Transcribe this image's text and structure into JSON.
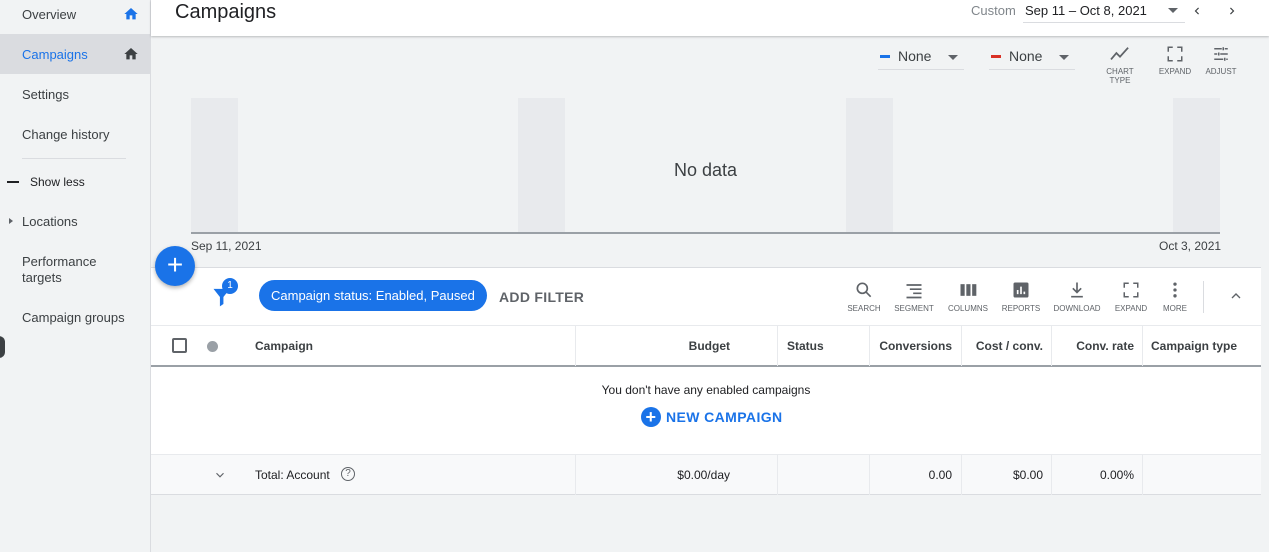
{
  "sidebar": {
    "items": [
      {
        "label": "Overview"
      },
      {
        "label": "Campaigns"
      },
      {
        "label": "Settings"
      },
      {
        "label": "Change history"
      }
    ],
    "show_less": "Show less",
    "sub_items": [
      {
        "label": "Locations"
      },
      {
        "label": "Performance targets"
      },
      {
        "label": "Campaign groups"
      }
    ]
  },
  "header": {
    "title": "Campaigns",
    "date_preset": "Custom",
    "date_range": "Sep 11 – Oct 8, 2021"
  },
  "chart_controls": {
    "metric1": {
      "label": "None",
      "color": "#1a73e8"
    },
    "metric2": {
      "label": "None",
      "color": "#d93025"
    },
    "chart_type": "CHART TYPE",
    "expand": "EXPAND",
    "adjust": "ADJUST"
  },
  "chart_data": {
    "type": "line",
    "x_start_label": "Sep 11, 2021",
    "x_end_label": "Oct 3, 2021",
    "series": [],
    "message": "No data"
  },
  "table_toolbar": {
    "filter_count": "1",
    "filter_chip": "Campaign status: Enabled, Paused",
    "add_filter": "ADD FILTER",
    "search": "SEARCH",
    "segment": "SEGMENT",
    "columns": "COLUMNS",
    "reports": "REPORTS",
    "download": "DOWNLOAD",
    "expand": "EXPAND",
    "more": "MORE"
  },
  "table": {
    "headers": {
      "campaign": "Campaign",
      "budget": "Budget",
      "status": "Status",
      "conversions": "Conversions",
      "cost_conv": "Cost / conv.",
      "conv_rate": "Conv. rate",
      "campaign_type": "Campaign type"
    },
    "empty_message": "You don't have any enabled campaigns",
    "new_campaign": "NEW CAMPAIGN",
    "total": {
      "label": "Total: Account",
      "budget": "$0.00/day",
      "status": "",
      "conversions": "0.00",
      "cost_conv": "$0.00",
      "conv_rate": "0.00%",
      "campaign_type": ""
    }
  }
}
